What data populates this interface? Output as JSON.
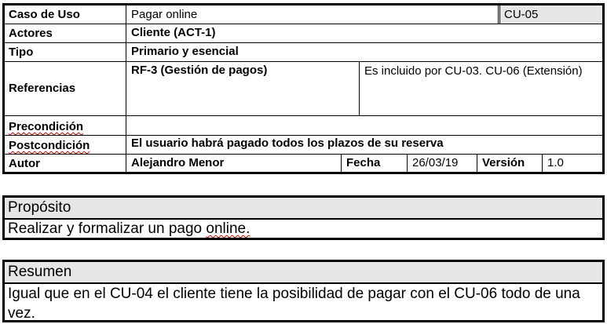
{
  "caso": {
    "label_caso": "Caso de Uso",
    "nombre": "Pagar online",
    "codigo": "CU-05",
    "label_actores": "Actores",
    "actores": "Cliente (ACT-1)",
    "label_tipo": "Tipo",
    "tipo": "Primario y esencial",
    "label_referencias": "Referencias",
    "referencia_rf": "RF-3 (Gestión de pagos)",
    "referencia_cu": "Es incluido por CU-03. CU-06 (Extensión)",
    "label_precondicion": "Precondición",
    "precondicion": "",
    "label_postcondicion": "Postcondición",
    "postcondicion": "El usuario habrá pagado todos los plazos de su reserva",
    "label_autor": "Autor",
    "autor": "Alejandro Menor",
    "label_fecha": "Fecha",
    "fecha": "26/03/19",
    "label_version": "Versión",
    "version": "1.0"
  },
  "proposito": {
    "titulo": "Propósito",
    "texto": "Realizar y formalizar un pago online."
  },
  "resumen": {
    "titulo": "Resumen",
    "texto": "Igual que en el CU-04 el cliente tiene la posibilidad de pagar con el CU-06 todo de una vez."
  }
}
